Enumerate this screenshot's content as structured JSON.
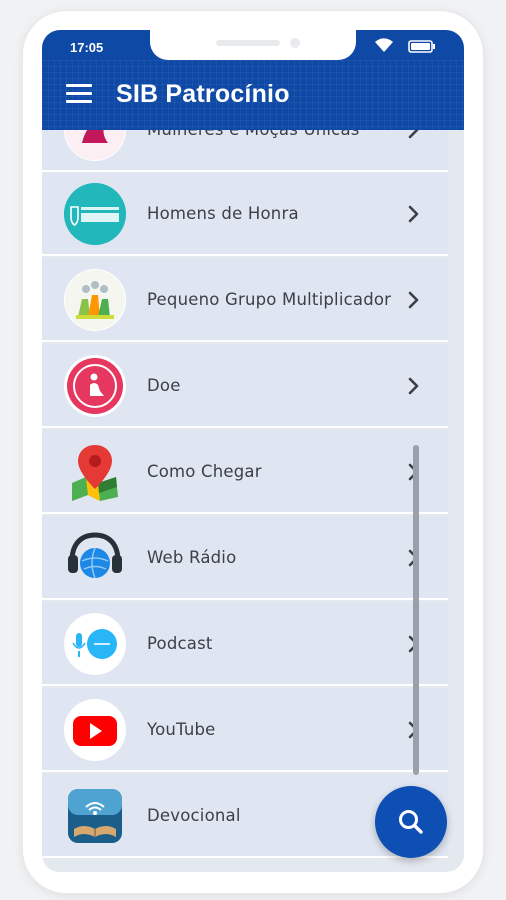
{
  "status_bar": {
    "time": "17:05",
    "wifi_icon": "wifi-icon",
    "battery_icon": "battery-icon"
  },
  "app_bar": {
    "title": "SIB Patrocínio",
    "menu_icon": "menu-icon"
  },
  "menu_items": [
    {
      "label": "Mulheres e Moças Únicas",
      "icon": "women-ministry-icon"
    },
    {
      "label": "Homens de Honra",
      "icon": "homens-de-honra-logo"
    },
    {
      "label": "Pequeno Grupo Multiplicador",
      "icon": "small-group-icon"
    },
    {
      "label": "Doe",
      "icon": "donate-prayer-icon"
    },
    {
      "label": "Como Chegar",
      "icon": "map-pin-icon"
    },
    {
      "label": "Web Rádio",
      "icon": "headphones-globe-icon"
    },
    {
      "label": "Podcast",
      "icon": "podcast-microphone-icon"
    },
    {
      "label": "YouTube",
      "icon": "youtube-icon"
    },
    {
      "label": "Devocional",
      "icon": "bible-broadcast-icon"
    }
  ],
  "fab": {
    "icon": "search-icon"
  },
  "colors": {
    "primary": "#0e49a6",
    "list_bg": "#dfe6f2",
    "text": "#3c3f46"
  }
}
